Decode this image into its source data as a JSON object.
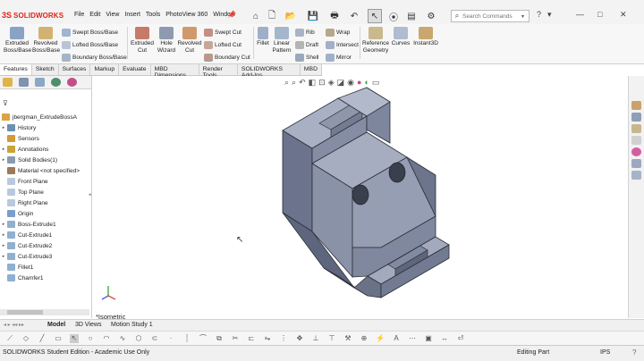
{
  "app": {
    "logo_prefix": "3S",
    "logo_name": "SOLIDWORKS"
  },
  "menus": [
    "File",
    "Edit",
    "View",
    "Insert",
    "Tools",
    "PhotoView 360",
    "Window"
  ],
  "search": {
    "placeholder": "Search Commands"
  },
  "ribbon": {
    "extruded_boss": "Extruded\nBoss/Base",
    "revolved_boss": "Revolved\nBoss/Base",
    "swept_boss": "Swept Boss/Base",
    "lofted_boss": "Lofted Boss/Base",
    "boundary_boss": "Boundary Boss/Base",
    "extruded_cut": "Extruded\nCut",
    "hole_wizard": "Hole\nWizard",
    "revolved_cut": "Revolved\nCut",
    "swept_cut": "Swept Cut",
    "lofted_cut": "Lofted Cut",
    "boundary_cut": "Boundary Cut",
    "fillet": "Fillet",
    "linear_pattern": "Linear\nPattern",
    "rib": "Rib",
    "draft": "Draft",
    "shell": "Shell",
    "wrap": "Wrap",
    "intersect": "Intersect",
    "mirror": "Mirror",
    "reference_geometry": "Reference\nGeometry",
    "curves": "Curves",
    "instant3d": "Instant3D"
  },
  "command_tabs": [
    "Features",
    "Sketch",
    "Surfaces",
    "Markup",
    "Evaluate",
    "MBD Dimensions",
    "Render Tools",
    "SOLIDWORKS Add-Ins",
    "MBD"
  ],
  "active_tab": "Features",
  "tree": {
    "root": "jbergman_ExtrudeBossA",
    "items": [
      {
        "label": "History",
        "arrow": "▸",
        "color": "#6d8fb3"
      },
      {
        "label": "Sensors",
        "arrow": "",
        "color": "#d29a3a"
      },
      {
        "label": "Annotations",
        "arrow": "▸",
        "color": "#c8a53a"
      },
      {
        "label": "Solid Bodies(1)",
        "arrow": "▸",
        "color": "#8a9ab0"
      },
      {
        "label": "Material <not specified>",
        "arrow": "",
        "color": "#9a7a5a"
      },
      {
        "label": "Front Plane",
        "arrow": "",
        "color": "#b9c9dc"
      },
      {
        "label": "Top Plane",
        "arrow": "",
        "color": "#b9c9dc"
      },
      {
        "label": "Right Plane",
        "arrow": "",
        "color": "#b9c9dc"
      },
      {
        "label": "Origin",
        "arrow": "",
        "color": "#7aa0c8"
      },
      {
        "label": "Boss-Extrude1",
        "arrow": "▸",
        "color": "#8fb0d0"
      },
      {
        "label": "Cut-Extrude1",
        "arrow": "▸",
        "color": "#8fb0d0"
      },
      {
        "label": "Cut-Extrude2",
        "arrow": "▸",
        "color": "#8fb0d0"
      },
      {
        "label": "Cut-Extrude3",
        "arrow": "▸",
        "color": "#8fb0d0"
      },
      {
        "label": "Fillet1",
        "arrow": "",
        "color": "#8fb0d0"
      },
      {
        "label": "Chamfer1",
        "arrow": "",
        "color": "#8fb0d0"
      }
    ]
  },
  "view_name": "*Isometric",
  "bottom_tabs": [
    "Model",
    "3D Views",
    "Motion Study 1"
  ],
  "active_bottom_tab": "Model",
  "status": {
    "edition": "SOLIDWORKS Student Edition - Academic Use Only",
    "mode": "Editing Part",
    "units": "IPS",
    "help": "?"
  },
  "colors": {
    "brand": "#e2231a",
    "part_face_top": "#9ea6bb",
    "part_face_side": "#6f7890",
    "part_face_front": "#848ca3"
  }
}
